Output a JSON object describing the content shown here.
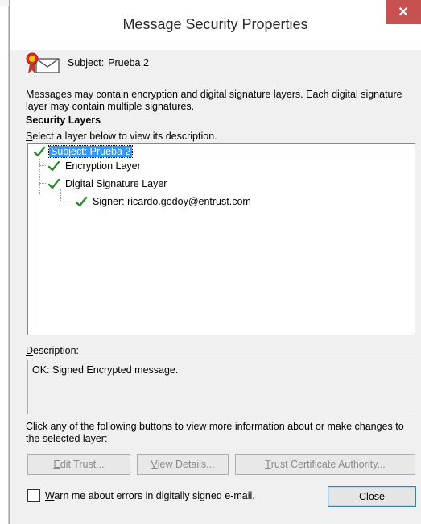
{
  "window": {
    "title": "Message Security Properties",
    "close_glyph": "✕"
  },
  "subject": {
    "icon": "certificate-envelope-icon",
    "label": "Subject:",
    "value": "Prueba 2"
  },
  "intro_text": "Messages may contain encryption and digital signature layers. Each digital signature layer may contain multiple signatures.",
  "security_layers": {
    "heading": "Security Layers",
    "hint_mnemonic": "S",
    "hint_rest": "elect a layer below to view its description.",
    "tree": [
      {
        "label": "Subject: Prueba 2",
        "selected": true
      },
      {
        "label": "Encryption Layer",
        "selected": false
      },
      {
        "label": "Digital Signature Layer",
        "selected": false
      },
      {
        "label": "Signer: ricardo.godoy@entrust.com",
        "selected": false
      }
    ]
  },
  "description": {
    "label_mnemonic": "D",
    "label_rest": "escription:",
    "text": "OK: Signed Encrypted message."
  },
  "info_text": "Click any of the following buttons to view more information about or make changes to the selected layer:",
  "buttons": {
    "edit_trust": {
      "mnemonic": "E",
      "rest": "dit Trust..."
    },
    "view_details": {
      "mnemonic": "V",
      "rest": "iew Details..."
    },
    "trust_ca": {
      "mnemonic": "T",
      "rest": "rust Certificate Authority..."
    },
    "close": {
      "mnemonic": "C",
      "rest": "lose"
    }
  },
  "warn_checkbox": {
    "mnemonic": "W",
    "rest": "arn me about errors in digitally signed e-mail.",
    "checked": false
  },
  "colors": {
    "selection": "#3399ff",
    "check_green": "#2d8a2d",
    "close_red": "#c75050"
  }
}
